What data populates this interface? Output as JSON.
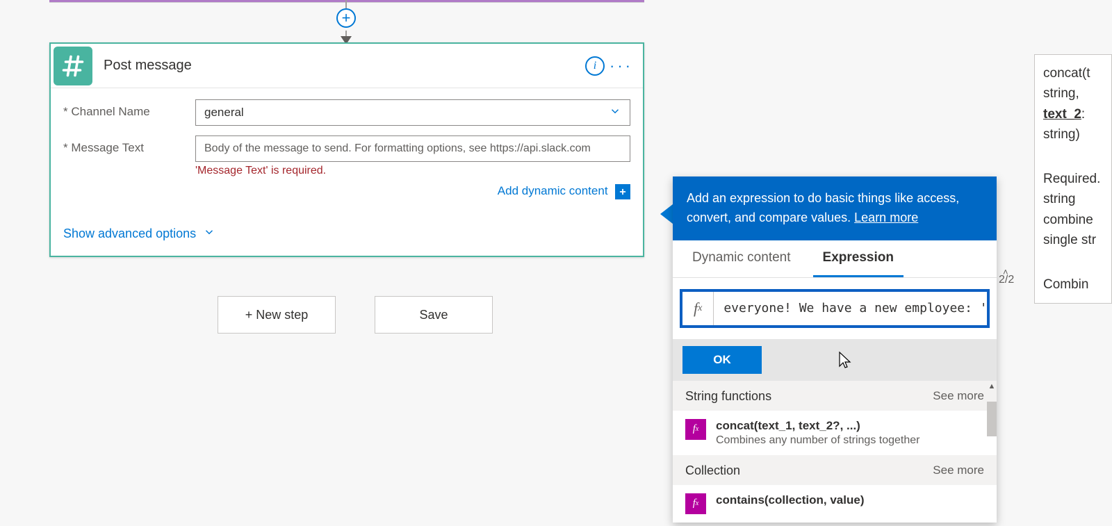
{
  "connector": {
    "plus_label": "+"
  },
  "card": {
    "title": "Post message",
    "info_char": "i",
    "menu_char": "···",
    "fields": {
      "channel": {
        "label": "Channel Name",
        "req": "*",
        "value": "general"
      },
      "message": {
        "label": "Message Text",
        "req": "*",
        "placeholder": "Body of the message to send. For formatting options, see https://api.slack.com",
        "error": "'Message Text' is required."
      }
    },
    "dynamic_link": "Add dynamic content",
    "dynamic_badge": "+",
    "advanced_link": "Show advanced options"
  },
  "footer": {
    "new_step": "+ New step",
    "save": "Save"
  },
  "panel": {
    "banner_text": "Add an expression to do basic things like access, convert, and compare values.",
    "learn_more": "Learn more",
    "tabs": {
      "dynamic": "Dynamic content",
      "expression": "Expression"
    },
    "fx": "fx",
    "expr_value": "everyone! We have a new employee: ', )",
    "ok": "OK",
    "sections": [
      {
        "title": "String functions",
        "see_more": "See more",
        "items": [
          {
            "name": "concat(text_1, text_2?, ...)",
            "desc": "Combines any number of strings together"
          }
        ]
      },
      {
        "title": "Collection",
        "see_more": "See more",
        "items": [
          {
            "name": "contains(collection, value)",
            "desc": ""
          }
        ]
      }
    ],
    "counter": "2/2"
  },
  "tooltip": {
    "line1": "concat(t",
    "line2": "string,",
    "line3": "text_2",
    "line4": "string)",
    "line5": "Required.",
    "line6": "string",
    "line7": "combine",
    "line8": "single str",
    "line9": "Combin"
  }
}
